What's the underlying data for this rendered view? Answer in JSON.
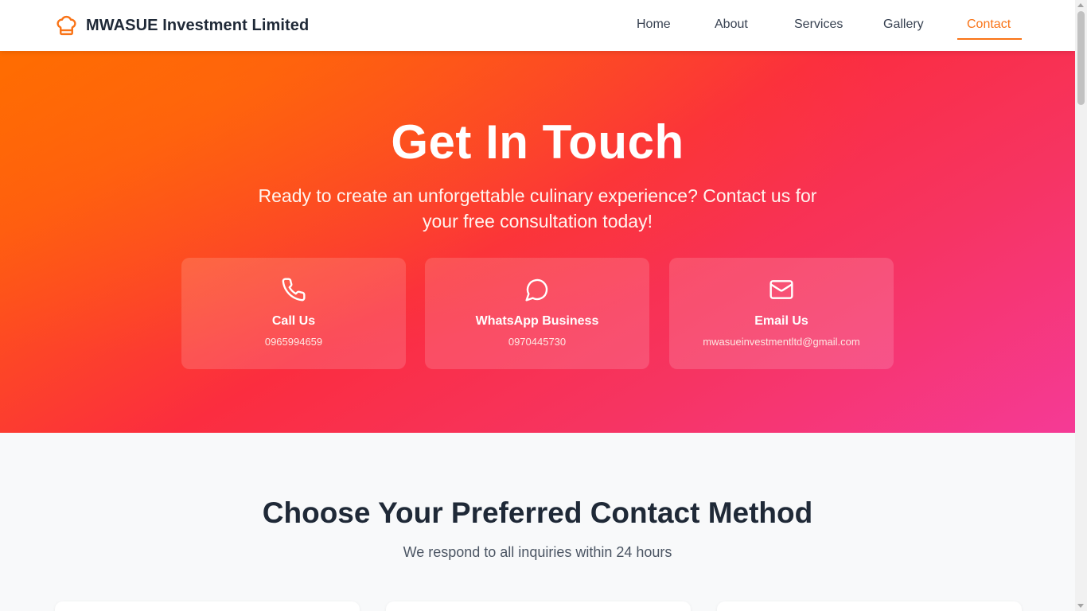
{
  "brand": {
    "name": "MWASUE Investment Limited",
    "icon": "chef-hat-icon",
    "accent_color": "#f97316"
  },
  "nav": {
    "items": [
      {
        "label": "Home",
        "active": false
      },
      {
        "label": "About",
        "active": false
      },
      {
        "label": "Services",
        "active": false
      },
      {
        "label": "Gallery",
        "active": false
      },
      {
        "label": "Contact",
        "active": true
      }
    ]
  },
  "hero": {
    "title": "Get In Touch",
    "subtitle": "Ready to create an unforgettable culinary experience? Contact us for your free consultation today!",
    "gradient_colors": [
      "#ff6a00",
      "#fb2d3f",
      "#f53a96"
    ],
    "cards": [
      {
        "icon": "phone-icon",
        "title": "Call Us",
        "value": "0965994659"
      },
      {
        "icon": "chat-bubble-icon",
        "title": "WhatsApp Business",
        "value": "0970445730"
      },
      {
        "icon": "mail-icon",
        "title": "Email Us",
        "value": "mwasueinvestmentltd@gmail.com"
      }
    ]
  },
  "section": {
    "title": "Choose Your Preferred Contact Method",
    "subtitle": "We respond to all inquiries within 24 hours"
  }
}
